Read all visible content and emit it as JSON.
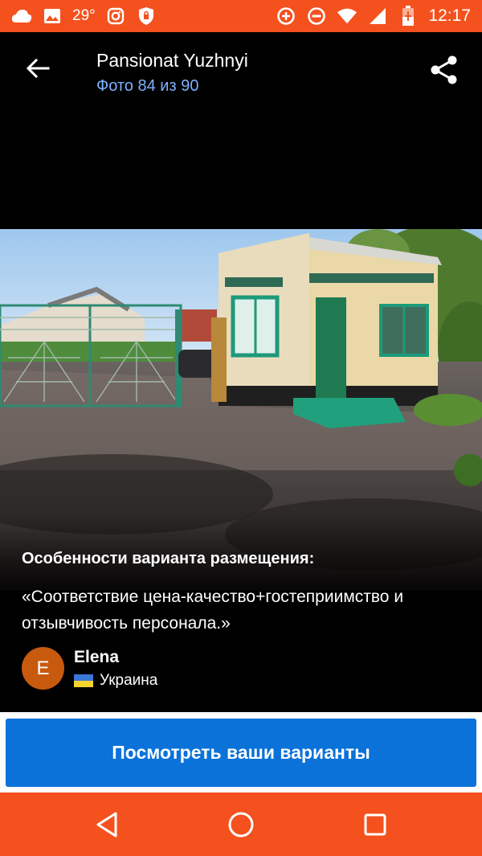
{
  "status_bar": {
    "temperature": "29°",
    "time": "12:17",
    "left_icons": [
      "cloud-icon",
      "image-icon",
      "instagram-icon",
      "shield-icon"
    ],
    "right_icons": [
      "data-saver-icon",
      "do-not-disturb-icon",
      "wifi-icon",
      "signal-icon",
      "battery-charging-icon"
    ]
  },
  "header": {
    "title": "Pansionat Yuzhnyi",
    "photo_counter": "Фото 84 из 90",
    "back_icon": "arrow-back-icon",
    "share_icon": "share-icon"
  },
  "photo": {
    "description_icon": "hotel-entrance-photo"
  },
  "review": {
    "heading": "Особенности варианта размещения:",
    "quote": "«Соответствие цена-качество+гостеприимство и отзывчивость персонала.»",
    "reviewer": {
      "initial": "E",
      "name": "Elena",
      "country": "Украина",
      "avatar_color": "#c85a0e"
    }
  },
  "cta": {
    "label": "Посмотреть ваши варианты",
    "color": "#0a72d8"
  },
  "nav_bar": {
    "color": "#f4511e",
    "items": [
      "back-nav-icon",
      "home-nav-icon",
      "recents-nav-icon"
    ]
  }
}
